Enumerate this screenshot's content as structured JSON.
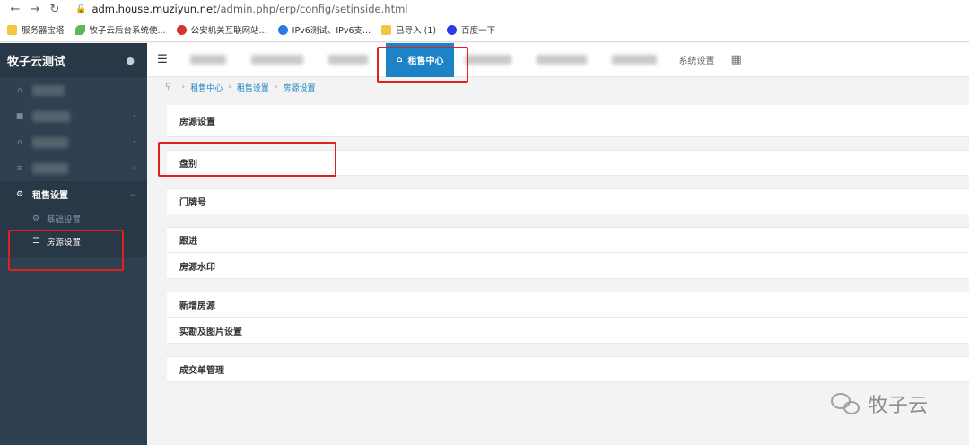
{
  "browser": {
    "url_host": "adm.house.muziyun.net",
    "url_path": "/admin.php/erp/config/setinside.html",
    "bookmarks": [
      {
        "label": "服务器宝塔",
        "icon": "folder"
      },
      {
        "label": "牧子云后台系统使...",
        "icon": "leaf"
      },
      {
        "label": "公安机关互联网站...",
        "icon": "police"
      },
      {
        "label": "IPv6测试、IPv6支...",
        "icon": "ipv6"
      },
      {
        "label": "已导入 (1)",
        "icon": "folder"
      },
      {
        "label": "百度一下",
        "icon": "baidu"
      }
    ]
  },
  "sidebar": {
    "brand": "牧子云测试",
    "active_section": "租售设置",
    "sub_items": [
      {
        "label": "基础设置"
      },
      {
        "label": "房源设置"
      }
    ]
  },
  "topnav": {
    "active_tab": "租售中心",
    "tab_system": "系统设置"
  },
  "breadcrumb": {
    "items": [
      "租售中心",
      "租售设置",
      "房源设置"
    ]
  },
  "content": {
    "panel_title": "房源设置",
    "rows": [
      "盘别",
      "门牌号",
      "跟进",
      "房源水印",
      "新增房源",
      "实勘及图片设置",
      "成交单管理"
    ]
  },
  "watermark": {
    "text": "牧子云"
  },
  "colors": {
    "sidebar_bg": "#2f4050",
    "accent": "#1c84c6",
    "annotation": "#e02020"
  }
}
